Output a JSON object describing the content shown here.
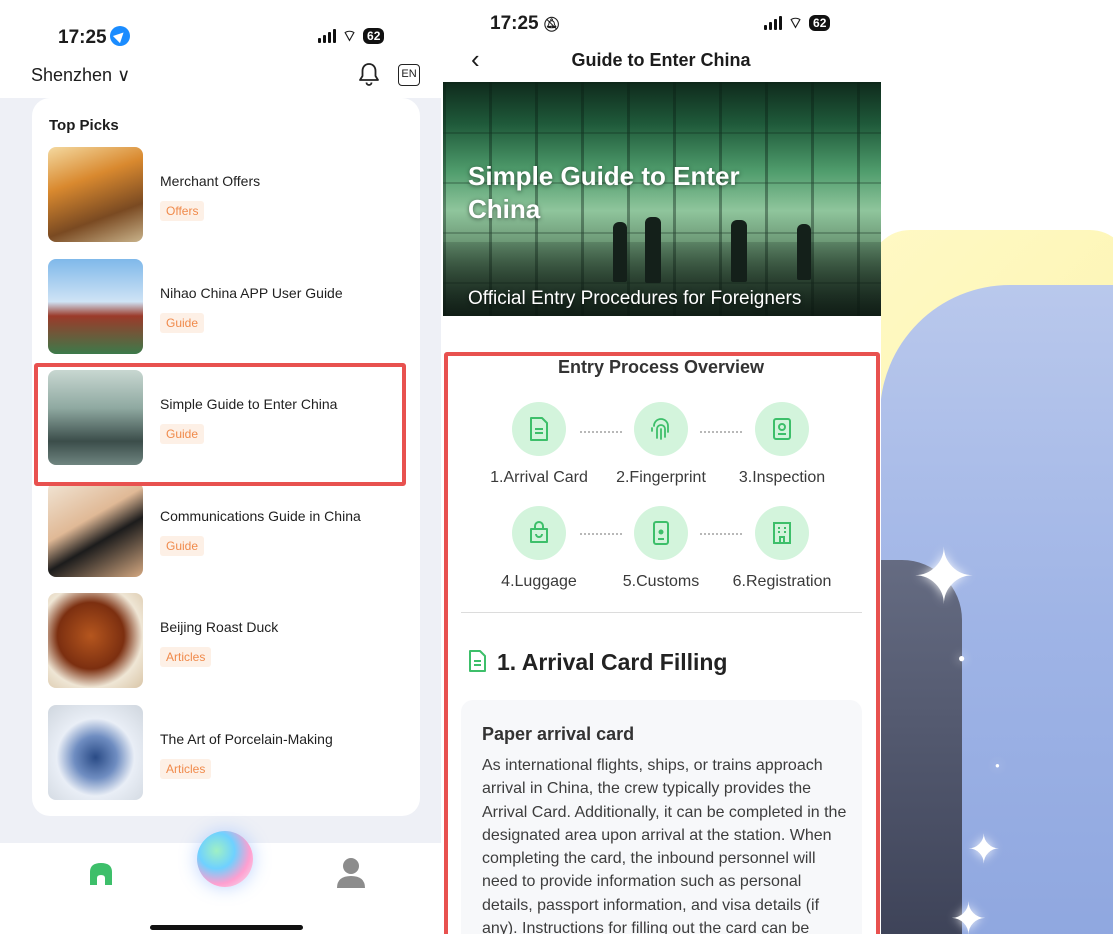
{
  "left_screen": {
    "status": {
      "time": "17:25",
      "battery": "62"
    },
    "header": {
      "city": "Shenzhen ∨",
      "lang_button": "EN"
    },
    "top_picks": {
      "title": "Top Picks",
      "items": [
        {
          "title": "Merchant Offers",
          "tag": "Offers"
        },
        {
          "title": "Nihao China APP User Guide",
          "tag": "Guide"
        },
        {
          "title": "Simple Guide to Enter China",
          "tag": "Guide"
        },
        {
          "title": "Communications Guide in China",
          "tag": "Guide"
        },
        {
          "title": "Beijing Roast Duck",
          "tag": "Articles"
        },
        {
          "title": "The Art of Porcelain-Making",
          "tag": "Articles"
        }
      ]
    }
  },
  "right_screen": {
    "status": {
      "time": "17:25",
      "battery": "62"
    },
    "header": {
      "back": "‹",
      "title": "Guide to Enter China"
    },
    "banner": {
      "title": "Simple Guide to Enter China",
      "subtitle": "Official Entry Procedures for Foreigners"
    },
    "overview": {
      "title": "Entry Process Overview",
      "steps": [
        {
          "label": "1.Arrival Card",
          "icon": "document-icon"
        },
        {
          "label": "2.Fingerprint",
          "icon": "fingerprint-icon"
        },
        {
          "label": "3.Inspection",
          "icon": "passport-icon"
        },
        {
          "label": "4.Luggage",
          "icon": "bag-icon"
        },
        {
          "label": "5.Customs",
          "icon": "id-badge-icon"
        },
        {
          "label": "6.Registration",
          "icon": "building-icon"
        }
      ]
    },
    "section": {
      "title": "1. Arrival Card Filling",
      "card_title": "Paper arrival card",
      "card_text": "As international flights, ships, or trains approach arrival in China, the crew typically provides the Arrival Card. Additionally, it can be completed in the designated area upon arrival at the station. When completing the card, the inbound personnel will need to provide information such as personal details, passport information, and visa details (if any). Instructions for filling out the card can be found in the 'Arrival Card Filling Guidelines' of this"
    }
  },
  "colors": {
    "accent_green": "#3dbf6a",
    "highlight_red": "#e8514f",
    "tag_orange": "#f08a4b"
  }
}
